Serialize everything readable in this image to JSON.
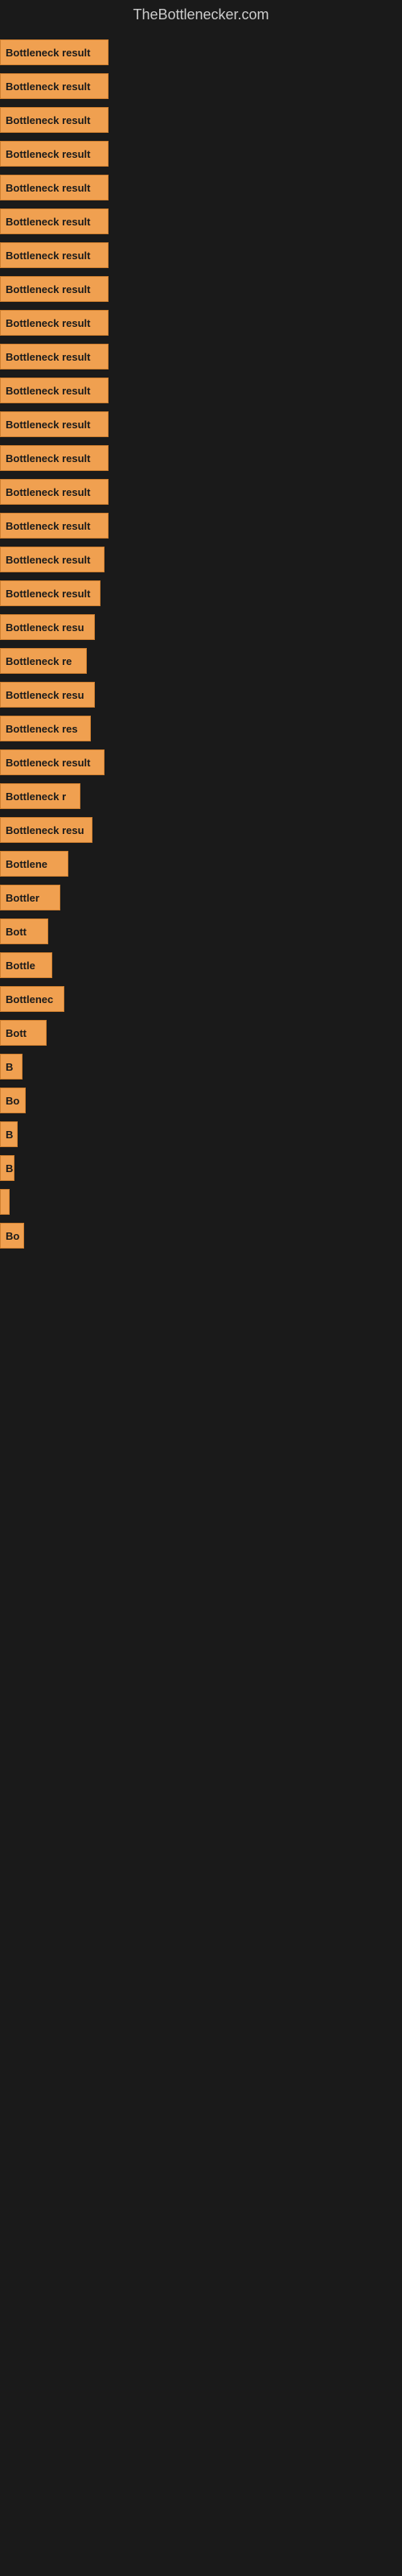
{
  "site": {
    "title": "TheBottlenecker.com"
  },
  "bars": [
    {
      "label": "Bottleneck result",
      "width": 135
    },
    {
      "label": "Bottleneck result",
      "width": 135
    },
    {
      "label": "Bottleneck result",
      "width": 135
    },
    {
      "label": "Bottleneck result",
      "width": 135
    },
    {
      "label": "Bottleneck result",
      "width": 135
    },
    {
      "label": "Bottleneck result",
      "width": 135
    },
    {
      "label": "Bottleneck result",
      "width": 135
    },
    {
      "label": "Bottleneck result",
      "width": 135
    },
    {
      "label": "Bottleneck result",
      "width": 135
    },
    {
      "label": "Bottleneck result",
      "width": 135
    },
    {
      "label": "Bottleneck result",
      "width": 135
    },
    {
      "label": "Bottleneck result",
      "width": 135
    },
    {
      "label": "Bottleneck result",
      "width": 135
    },
    {
      "label": "Bottleneck result",
      "width": 135
    },
    {
      "label": "Bottleneck result",
      "width": 135
    },
    {
      "label": "Bottleneck result",
      "width": 130
    },
    {
      "label": "Bottleneck result",
      "width": 125
    },
    {
      "label": "Bottleneck resu",
      "width": 118
    },
    {
      "label": "Bottleneck re",
      "width": 108
    },
    {
      "label": "Bottleneck resu",
      "width": 118
    },
    {
      "label": "Bottleneck res",
      "width": 113
    },
    {
      "label": "Bottleneck result",
      "width": 130
    },
    {
      "label": "Bottleneck r",
      "width": 100
    },
    {
      "label": "Bottleneck resu",
      "width": 115
    },
    {
      "label": "Bottlene",
      "width": 85
    },
    {
      "label": "Bottler",
      "width": 75
    },
    {
      "label": "Bott",
      "width": 60
    },
    {
      "label": "Bottle",
      "width": 65
    },
    {
      "label": "Bottlenec",
      "width": 80
    },
    {
      "label": "Bott",
      "width": 58
    },
    {
      "label": "B",
      "width": 28
    },
    {
      "label": "Bo",
      "width": 32
    },
    {
      "label": "B",
      "width": 22
    },
    {
      "label": "B",
      "width": 18
    },
    {
      "label": "",
      "width": 12
    },
    {
      "label": "Bo",
      "width": 30
    }
  ]
}
